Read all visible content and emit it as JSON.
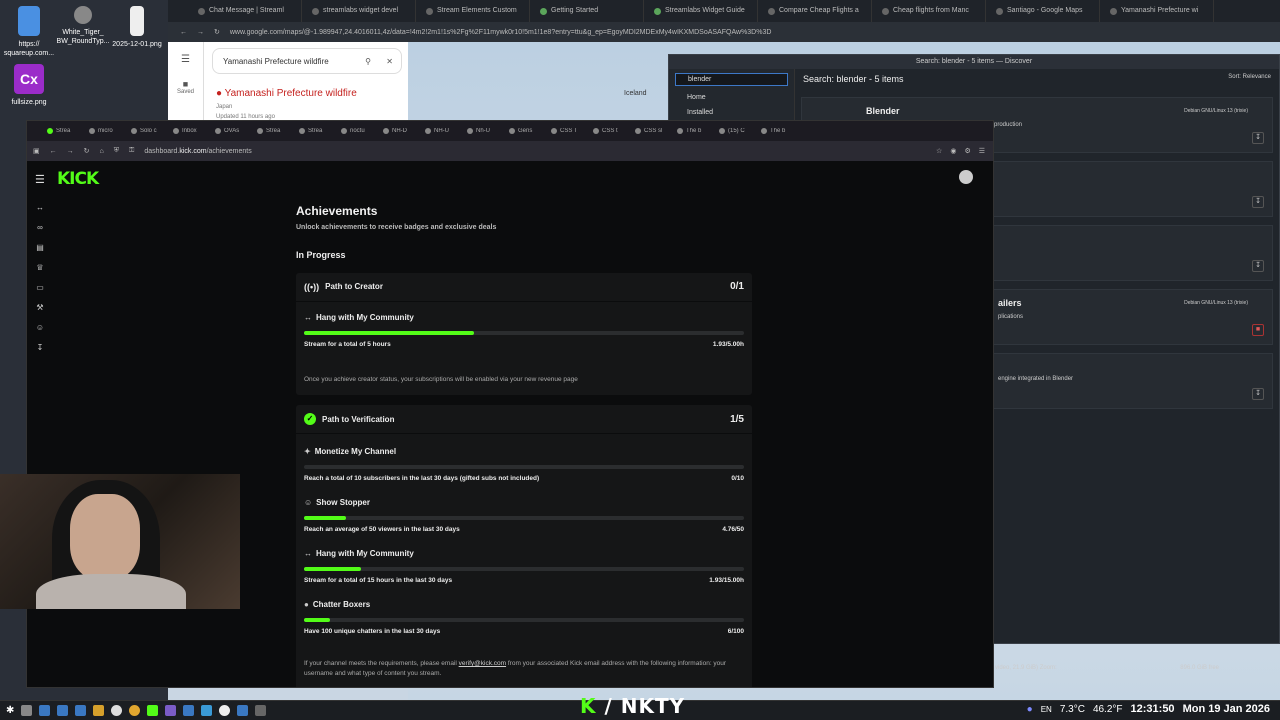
{
  "desktop": {
    "icons": [
      {
        "label": "https://\nsquareup.com..."
      },
      {
        "label": "White_Tiger_\nBW_RoundTyp..."
      },
      {
        "label": "2025-12-01.png"
      },
      {
        "label": "fullsize.png"
      }
    ]
  },
  "back_browser": {
    "tabs": [
      "Chat Message | Streaml",
      "streamlabs widget devel",
      "Stream Elements Custom",
      "Getting Started",
      "Streamlabs Widget Guide",
      "Compare Cheap Flights a",
      "Cheap flights from Manc",
      "Santiago - Google Maps",
      "Yamanashi Prefecture wi"
    ],
    "url": "www.google.com/maps/@-1.989947,24.4016011,4z/data=!4m2!2m1!1s%2Fg%2F11mywk0r10!5m1!1e8?entry=ttu&g_ep=EgoyMDI2MDExMy4wIKXMDSoASAFQAw%3D%3D",
    "maps": {
      "search_value": "Yamanashi Prefecture wildfire",
      "saved_label": "Saved",
      "result_title": "Yamanashi Prefecture wildfire",
      "result_sub": "Japan",
      "result_updated": "Updated 11 hours ago",
      "map_label": "Iceland"
    }
  },
  "discover": {
    "window_title": "Search: blender - 5 items — Discover",
    "search_value": "blender",
    "nav": [
      "Home",
      "Installed"
    ],
    "header": "Search: blender - 5 items",
    "sort": "Sort: Relevance",
    "cards": [
      {
        "title": "Blender",
        "frag": "-production",
        "source": "Debian GNU/Linux 13 (trixie)"
      },
      {
        "title": "",
        "frag": "",
        "source": ""
      },
      {
        "title": "",
        "frag": "",
        "source": ""
      },
      {
        "title": "ailers",
        "frag": "plications",
        "source": "Debian GNU/Linux 13 (trixie)"
      },
      {
        "title": "",
        "frag": "engine integrated in Blender",
        "source": ""
      }
    ],
    "footer": "video, 21.9 GiB) Zoom:",
    "free": "896.0 GiB free"
  },
  "firefox": {
    "tabs": [
      "Strea",
      "micro",
      "Solo c",
      "Inbox",
      "OVAs",
      "Strea",
      "Strea",
      "noctu",
      "NH-D",
      "NH-U",
      "Nh-U",
      "Gens",
      "CSS T",
      "CSS t",
      "CSS sl",
      "The b",
      "(15) C",
      "The b"
    ],
    "url_prefix": "dashboard.",
    "url_host": "kick.com",
    "url_path": "/achievements"
  },
  "kick": {
    "logo": "KICK",
    "title": "Achievements",
    "subtitle": "Unlock achievements to receive badges and exclusive deals",
    "in_progress": "In Progress",
    "creator": {
      "title": "Path to Creator",
      "count": "0/1",
      "tasks": [
        {
          "name": "Hang with My Community",
          "desc": "Stream for a total of 5 hours",
          "value": "1.93/5.00h",
          "progress": 0.386
        }
      ],
      "note": "Once you achieve creator status, your subscriptions will be enabled via your new revenue page"
    },
    "verification": {
      "title": "Path to Verification",
      "count": "1/5",
      "tasks": [
        {
          "name": "Monetize My Channel",
          "desc": "Reach a total of 10 subscribers in the last 30 days (gifted subs not included)",
          "value": "0/10",
          "progress": 0
        },
        {
          "name": "Show Stopper",
          "desc": "Reach an average of 50 viewers in the last 30 days",
          "value": "4.76/50",
          "progress": 0.095
        },
        {
          "name": "Hang with My Community",
          "desc": "Stream for a total of 15 hours in the last 30 days",
          "value": "1.93/15.00h",
          "progress": 0.129
        },
        {
          "name": "Chatter Boxers",
          "desc": "Have 100 unique chatters in the last 30 days",
          "value": "6/100",
          "progress": 0.06
        }
      ],
      "note_pre": "If your channel meets the requirements, please email ",
      "note_email": "verify@kick.com",
      "note_post": " from your associated Kick email address with the following information: your username and what type of content you stream."
    }
  },
  "taskbar": {
    "lang": "EN",
    "temp": "7.3°C",
    "temp2": "46.2°F",
    "time": "12:31:50",
    "date": "Mon 19 Jan 2026"
  },
  "overlay_brand": "NKTY",
  "colors": {
    "kick_green": "#53fc18"
  }
}
